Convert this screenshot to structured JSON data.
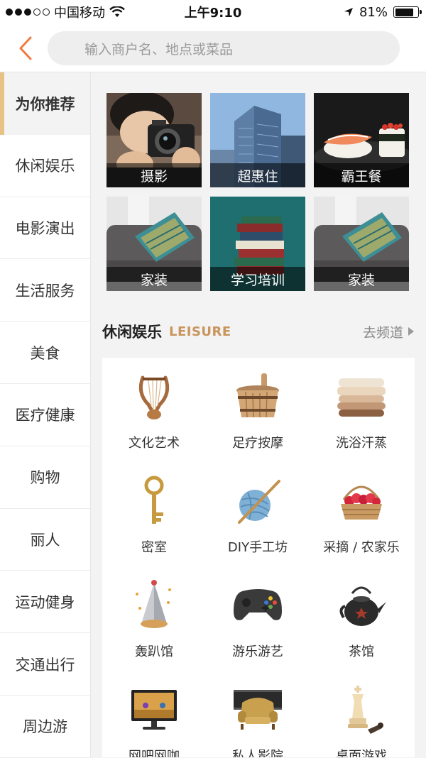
{
  "status_bar": {
    "carrier": "中国移动",
    "time": "上午9:10",
    "battery": "81%",
    "battery_level": 0.81
  },
  "search": {
    "placeholder": "输入商户名、地点或菜品"
  },
  "sidebar": {
    "items": [
      {
        "label": "为你推荐",
        "active": true
      },
      {
        "label": "休闲娱乐"
      },
      {
        "label": "电影演出"
      },
      {
        "label": "生活服务"
      },
      {
        "label": "美食"
      },
      {
        "label": "医疗健康"
      },
      {
        "label": "购物"
      },
      {
        "label": "丽人"
      },
      {
        "label": "运动健身"
      },
      {
        "label": "交通出行"
      },
      {
        "label": "周边游"
      }
    ]
  },
  "tiles": [
    {
      "label": "摄影",
      "icon": "camera-photo"
    },
    {
      "label": "超惠住",
      "icon": "skyscraper-photo"
    },
    {
      "label": "霸王餐",
      "icon": "sushi-photo"
    },
    {
      "label": "家装",
      "icon": "sofa-photo"
    },
    {
      "label": "学习培训",
      "icon": "books-photo"
    },
    {
      "label": "家装",
      "icon": "sofa-photo"
    }
  ],
  "section": {
    "title": "休闲娱乐",
    "title_en": "LEISURE",
    "link": "去频道"
  },
  "categories": [
    {
      "label": "文化艺术",
      "icon": "lyre-icon"
    },
    {
      "label": "足疗按摩",
      "icon": "bucket-icon"
    },
    {
      "label": "洗浴汗蒸",
      "icon": "towels-icon"
    },
    {
      "label": "密室",
      "icon": "key-icon"
    },
    {
      "label": "DIY手工坊",
      "icon": "yarn-icon"
    },
    {
      "label": "采摘 / 农家乐",
      "icon": "fruit-basket-icon"
    },
    {
      "label": "轰趴馆",
      "icon": "party-hat-icon"
    },
    {
      "label": "游乐游艺",
      "icon": "gamepad-icon"
    },
    {
      "label": "茶馆",
      "icon": "teapot-icon"
    },
    {
      "label": "网吧网咖",
      "icon": "monitor-icon"
    },
    {
      "label": "私人影院",
      "icon": "armchair-icon"
    },
    {
      "label": "桌面游戏",
      "icon": "chess-icon"
    }
  ],
  "colors": {
    "accent": "#f07b3f",
    "sidebar_indicator": "#e8c187",
    "section_en": "#c9955c"
  }
}
